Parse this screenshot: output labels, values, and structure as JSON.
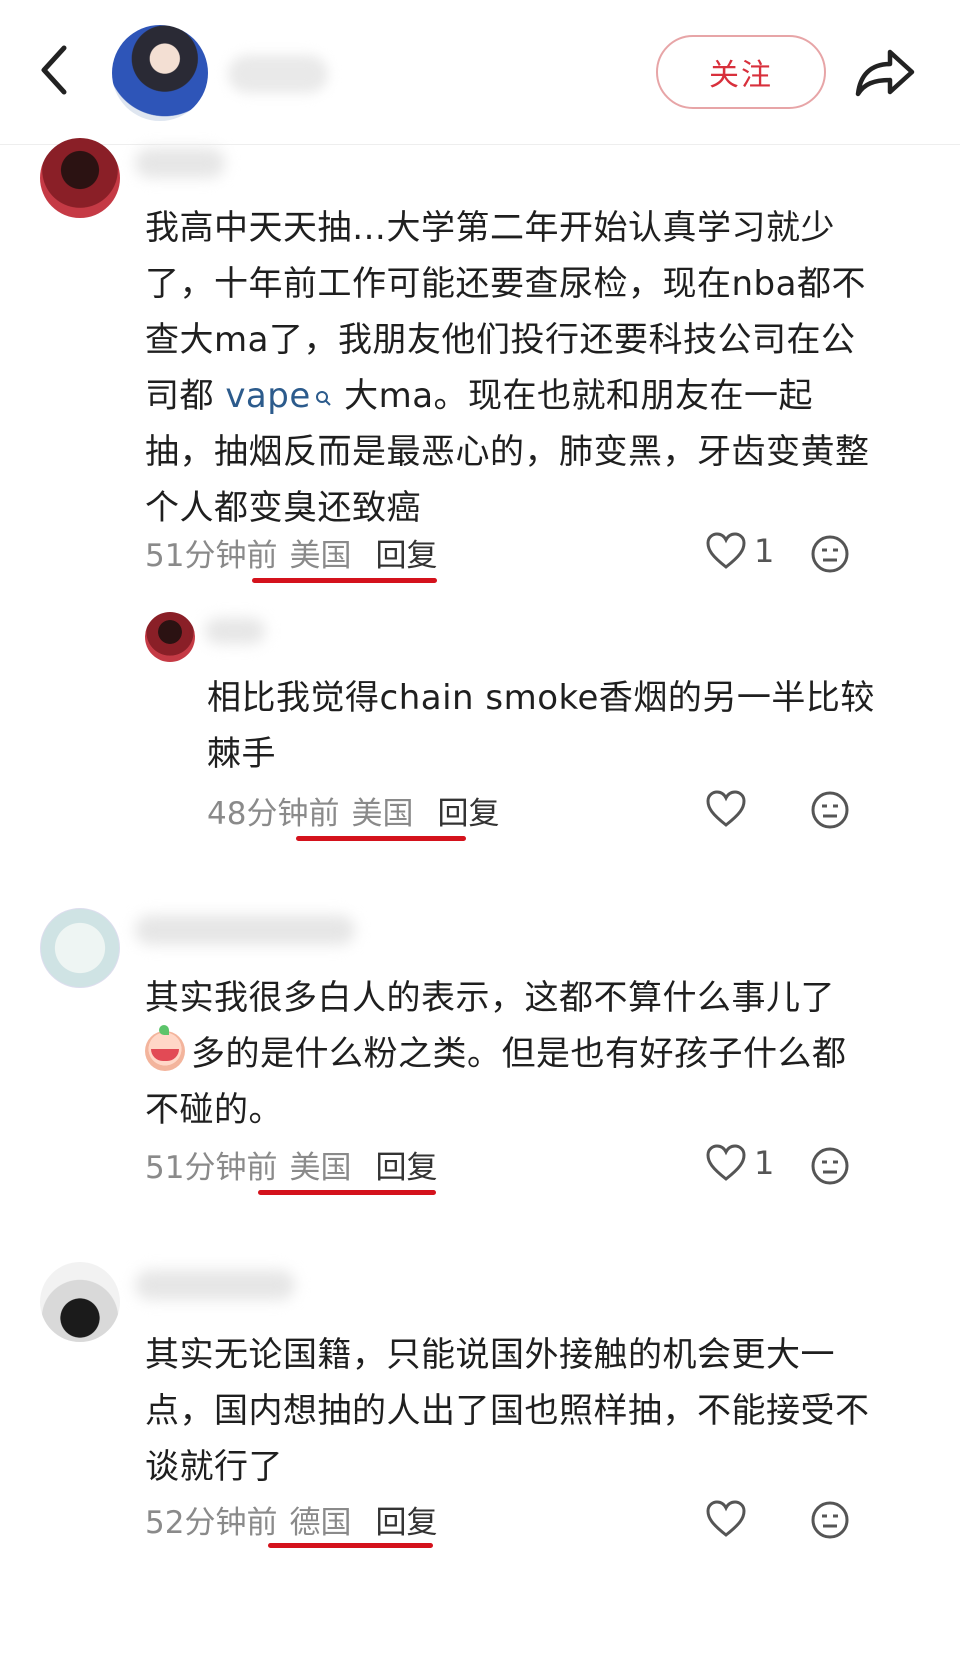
{
  "header": {
    "follow_label": "关注"
  },
  "comments": [
    {
      "text_parts": {
        "before": "我高中天天抽…大学第二年开始认真学习就少了，十年前工作可能还要查尿检，现在nba都不查大ma了，我朋友他们投行还要科技公司在公司都 ",
        "link": "vape",
        "after": " 大ma。现在也就和朋友在一起抽，抽烟反而是最恶心的，肺变黑，牙齿变黄整个人都变臭还致癌"
      },
      "time": "51分钟前",
      "location": "美国",
      "reply_label": "回复",
      "likes": "1"
    },
    {
      "text": "相比我觉得chain smoke香烟的另一半比较棘手",
      "time": "48分钟前",
      "location": "美国",
      "reply_label": "回复",
      "likes": ""
    },
    {
      "text_before_emoji": "其实我很多白人的表示，这都不算什么事儿了",
      "text_after_emoji": "多的是什么粉之类。但是也有好孩子什么都不碰的。",
      "time": "51分钟前",
      "location": "美国",
      "reply_label": "回复",
      "likes": "1"
    },
    {
      "text": "其实无论国籍，只能说国外接触的机会更大一点，国内想抽的人出了国也照样抽，不能接受不谈就行了",
      "time": "52分钟前",
      "location": "德国",
      "reply_label": "回复",
      "likes": ""
    }
  ],
  "colors": {
    "accent_red": "#d4121c",
    "follow_text": "#d8303c",
    "link_blue": "#2c5b8c"
  },
  "icons": [
    "back-arrow-icon",
    "share-icon",
    "heart-icon",
    "face-icon",
    "search-icon"
  ]
}
